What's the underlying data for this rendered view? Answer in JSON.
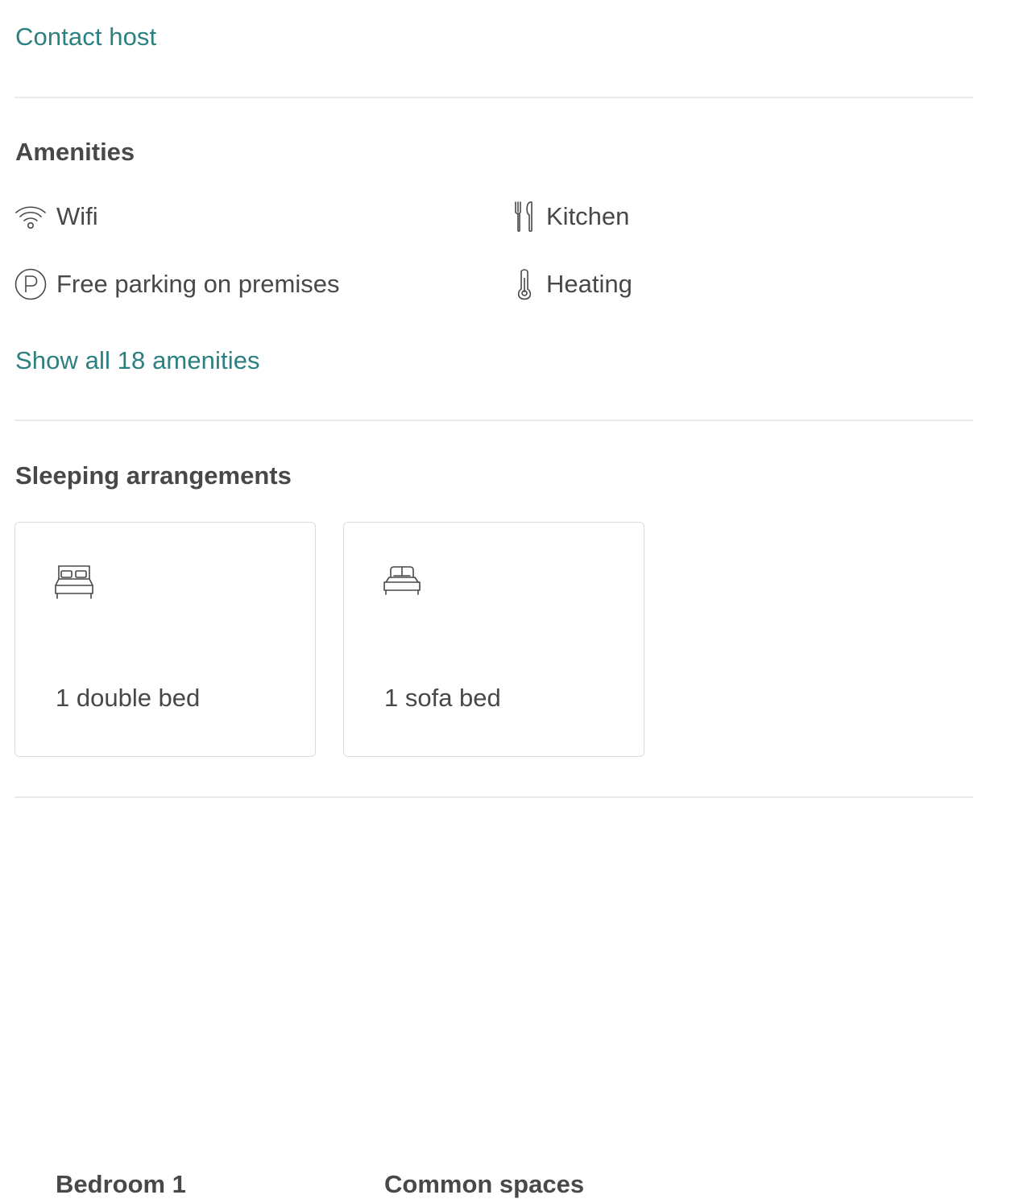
{
  "contact": {
    "label": "Contact host"
  },
  "amenities": {
    "title": "Amenities",
    "items": [
      {
        "label": "Wifi",
        "icon": "wifi-icon"
      },
      {
        "label": "Kitchen",
        "icon": "kitchen-icon"
      },
      {
        "label": "Free parking on premises",
        "icon": "parking-icon"
      },
      {
        "label": "Heating",
        "icon": "thermometer-icon"
      }
    ],
    "show_all_label": "Show all 18 amenities"
  },
  "sleeping": {
    "title": "Sleeping arrangements",
    "rooms": [
      {
        "name": "Bedroom 1",
        "beds": "1 double bed",
        "icon": "double-bed-icon"
      },
      {
        "name": "Common spaces",
        "beds": "1 sofa bed",
        "icon": "sofa-bed-icon"
      }
    ]
  },
  "colors": {
    "link": "#2c8080",
    "text": "#484848",
    "divider": "#ebebeb",
    "card_border": "#dcdcdc"
  }
}
